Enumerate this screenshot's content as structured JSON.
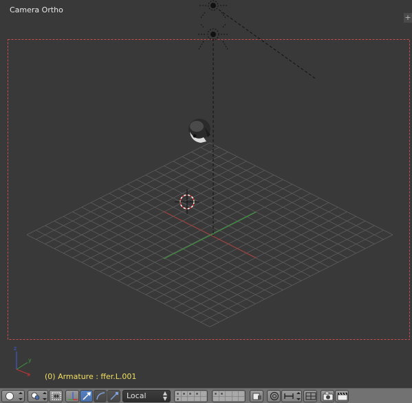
{
  "viewport": {
    "title": "Camera Ortho",
    "status": "(0) Armature : ffer.L.001",
    "corner_button": "+"
  },
  "header": {
    "transform_orientation": "Local",
    "colors": {
      "bar": "#727272",
      "button": "#8c8c8c",
      "active": "#5680c2",
      "select_bg": "#333333"
    }
  },
  "scene_colors": {
    "background": "#393939",
    "camera_border": "#c85050",
    "grid": "#5a5a5a",
    "x_axis": "#a84040",
    "y_axis": "#3c9c3c",
    "cursor": "#c83232",
    "status_text": "#f0e060"
  },
  "icons": [
    "viewport-shading-icon",
    "pivot-point-icon",
    "proportional-link-icon",
    "manipulator-toggle-icon",
    "translate-manipulator-icon",
    "rotate-manipulator-icon",
    "scale-manipulator-icon",
    "lock-layer-icon",
    "proportional-edit-icon",
    "snap-icon",
    "snap-element-icon",
    "render-camera-icon",
    "render-animation-icon"
  ]
}
